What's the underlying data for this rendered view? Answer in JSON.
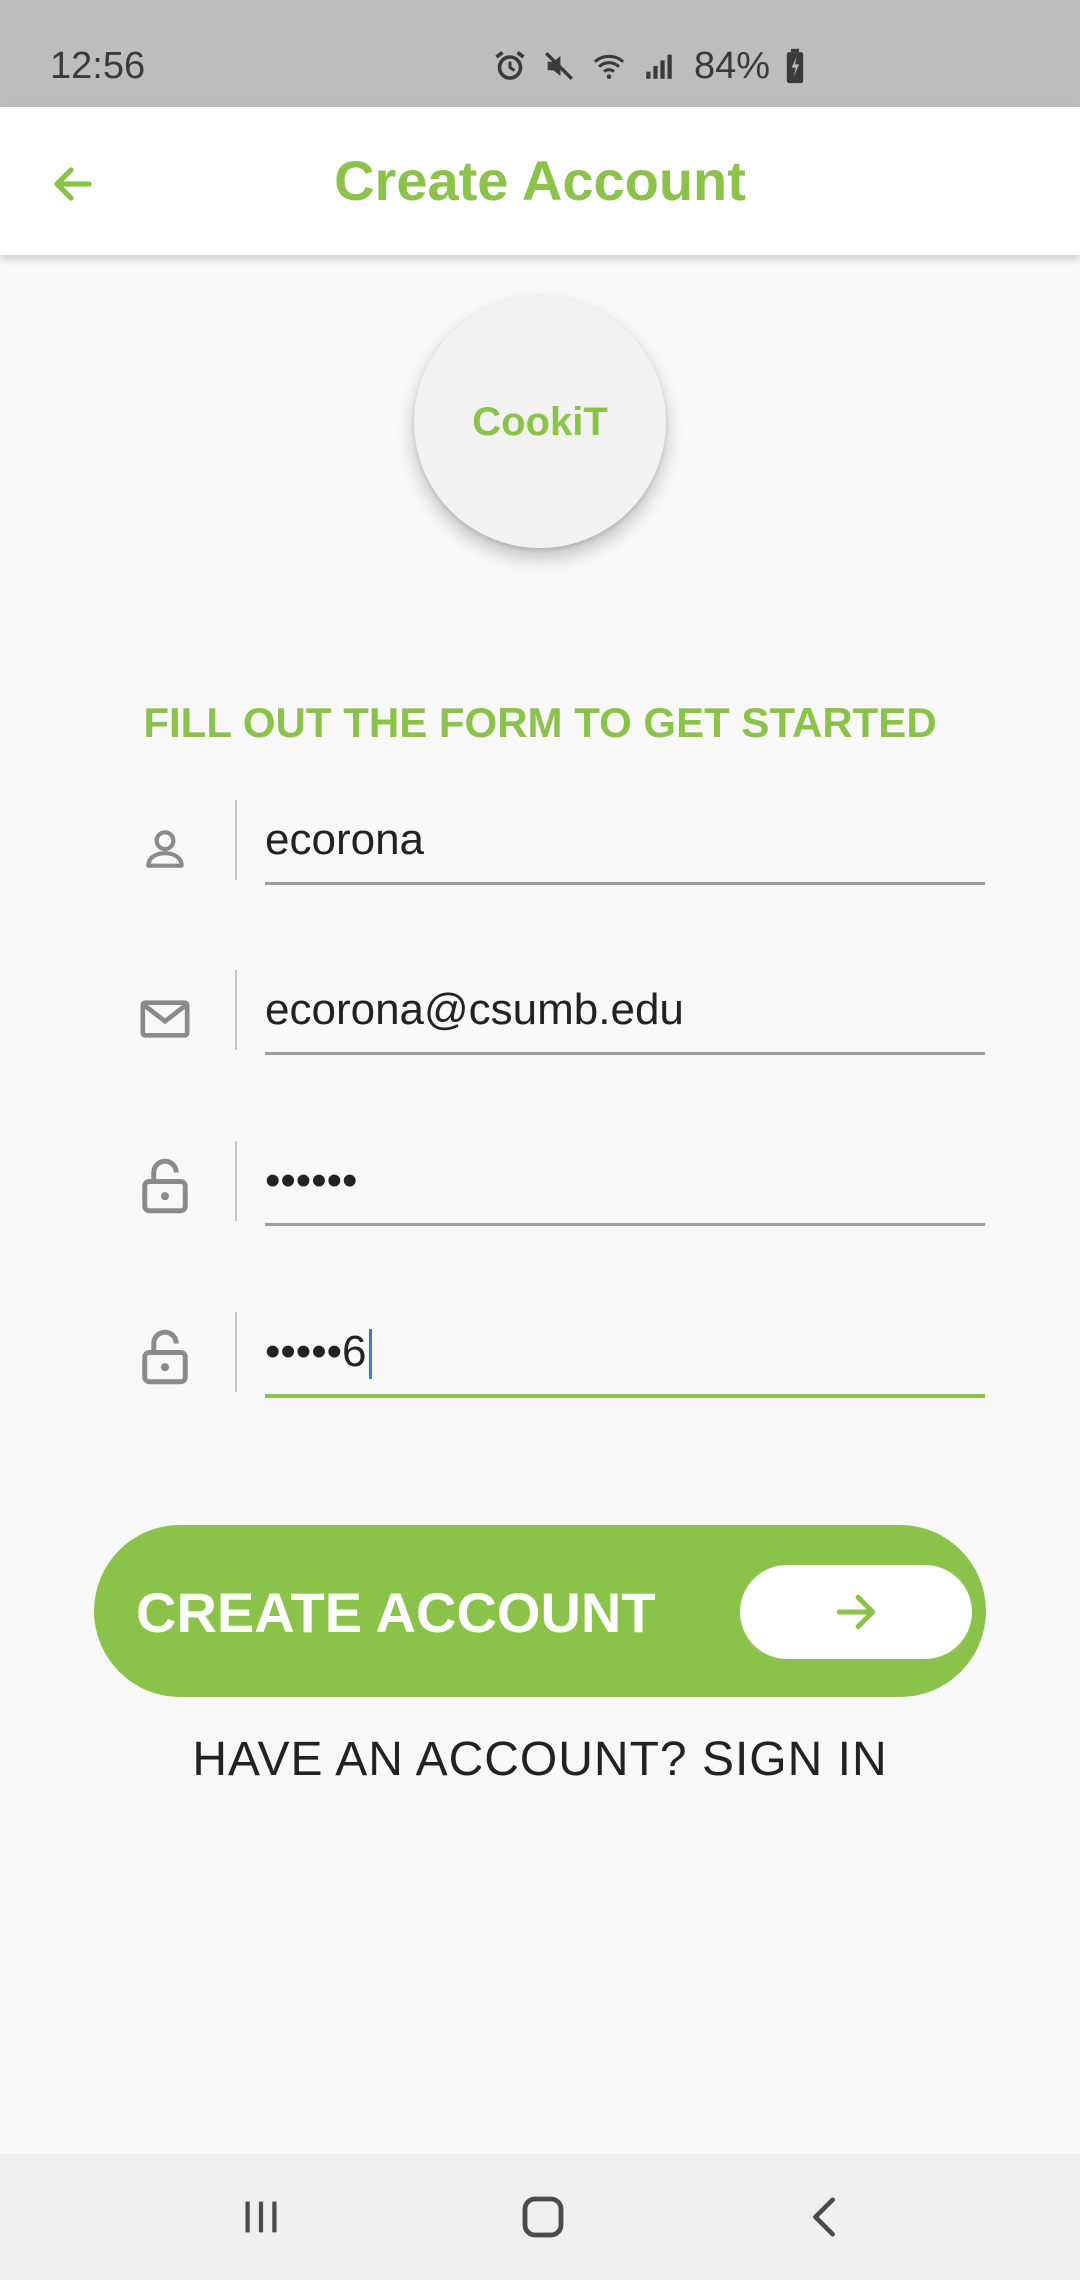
{
  "status_bar": {
    "time": "12:56",
    "battery": "84%",
    "icons": [
      "alarm-icon",
      "mute-icon",
      "wifi-icon",
      "signal-icon",
      "battery-icon"
    ]
  },
  "app_bar": {
    "title": "Create Account",
    "back_icon": "arrow-left-icon"
  },
  "logo": {
    "text": "CookiT"
  },
  "form": {
    "heading": "FILL OUT THE FORM TO GET STARTED",
    "fields": [
      {
        "icon": "person-icon",
        "value": "ecorona"
      },
      {
        "icon": "mail-icon",
        "value": "ecorona@csumb.edu"
      },
      {
        "icon": "lock-icon",
        "value": "••••••"
      },
      {
        "icon": "lock-icon",
        "value": "•••••6",
        "focused": true
      }
    ]
  },
  "create_button": {
    "label": "CREATE ACCOUNT",
    "icon": "arrow-right-icon"
  },
  "signin_link": "HAVE AN ACCOUNT? SIGN IN",
  "colors": {
    "accent": "#8bc34a",
    "status_bar": "#bdbdbd",
    "background": "#f8f8f8"
  },
  "nav_bar": {
    "icons": [
      "recent-apps-icon",
      "home-icon",
      "back-icon"
    ]
  }
}
